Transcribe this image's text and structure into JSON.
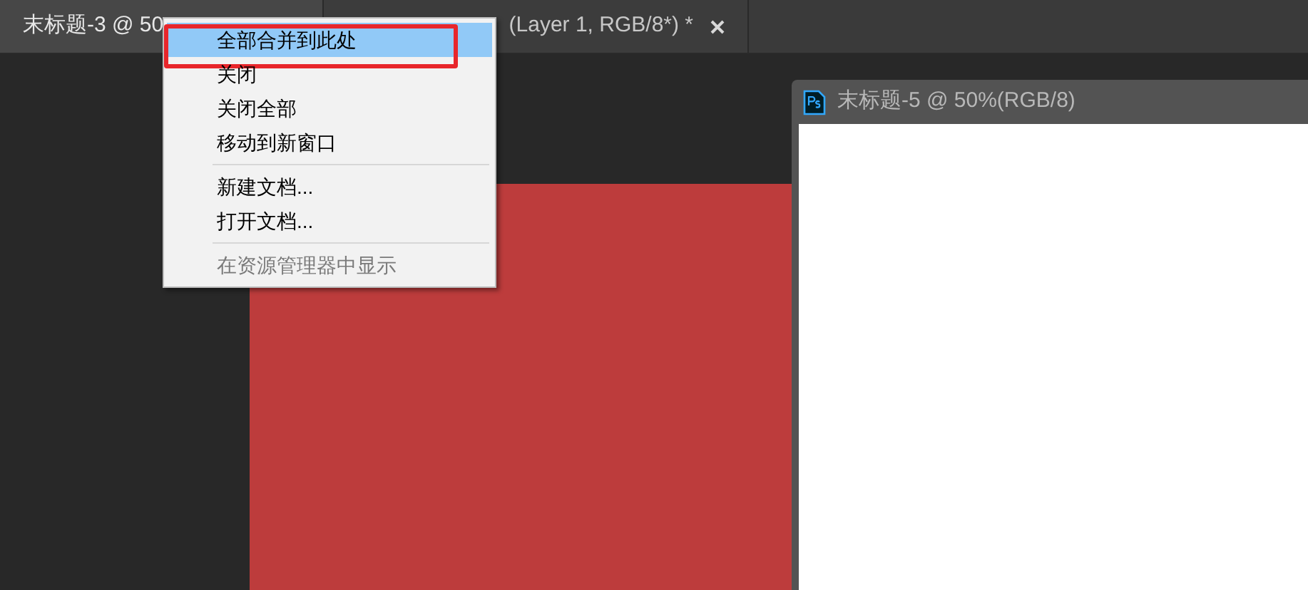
{
  "tabs": [
    {
      "label": "末标题-3 @ 50",
      "selected": true
    },
    {
      "label": "(Layer 1, RGB/8*) *",
      "selected": false,
      "closable": true
    }
  ],
  "context_menu": {
    "groups": [
      [
        {
          "label": "全部合并到此处",
          "selected": true,
          "disabled": false,
          "annotated": true
        },
        {
          "label": "关闭",
          "selected": false,
          "disabled": false,
          "annotated": false
        },
        {
          "label": "关闭全部",
          "selected": false,
          "disabled": false,
          "annotated": false
        },
        {
          "label": "移动到新窗口",
          "selected": false,
          "disabled": false,
          "annotated": false
        }
      ],
      [
        {
          "label": "新建文档...",
          "selected": false,
          "disabled": false,
          "annotated": false
        },
        {
          "label": "打开文档...",
          "selected": false,
          "disabled": false,
          "annotated": false
        }
      ],
      [
        {
          "label": "在资源管理器中显示",
          "selected": false,
          "disabled": true,
          "annotated": false
        }
      ]
    ]
  },
  "floating_document": {
    "title": "末标题-5 @ 50%(RGB/8)"
  }
}
